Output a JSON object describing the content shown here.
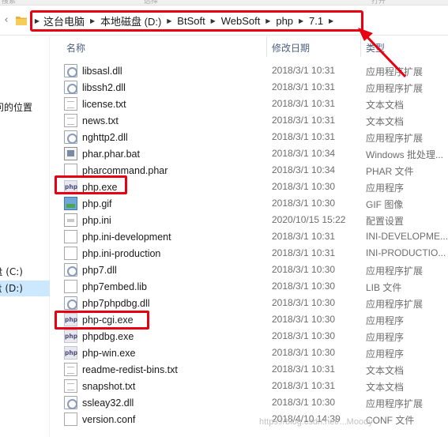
{
  "top_strip": {
    "left": "搜索",
    "middle": "选择",
    "right": "打开"
  },
  "breadcrumb": [
    "这台电脑",
    "本地磁盘 (D:)",
    "BtSoft",
    "WebSoft",
    "php",
    "7.1"
  ],
  "sidebar": {
    "items": [
      {
        "label": "问的位置"
      },
      {
        "label": "盘 (C:)"
      },
      {
        "label": "盘 (D:)"
      }
    ]
  },
  "columns": {
    "name": "名称",
    "date": "修改日期",
    "type": "类型"
  },
  "files": [
    {
      "name": "libsasl.dll",
      "date": "2018/3/1 10:31",
      "type": "应用程序扩展",
      "icon": "dll-icon"
    },
    {
      "name": "libssh2.dll",
      "date": "2018/3/1 10:31",
      "type": "应用程序扩展",
      "icon": "dll-icon"
    },
    {
      "name": "license.txt",
      "date": "2018/3/1 10:31",
      "type": "文本文档",
      "icon": "text-file-icon"
    },
    {
      "name": "news.txt",
      "date": "2018/3/1 10:31",
      "type": "文本文档",
      "icon": "text-file-icon"
    },
    {
      "name": "nghttp2.dll",
      "date": "2018/3/1 10:31",
      "type": "应用程序扩展",
      "icon": "dll-icon"
    },
    {
      "name": "phar.phar.bat",
      "date": "2018/3/1 10:34",
      "type": "Windows 批处理...",
      "icon": "batch-file-icon"
    },
    {
      "name": "pharcommand.phar",
      "date": "2018/3/1 10:34",
      "type": "PHAR 文件",
      "icon": "generic-file-icon"
    },
    {
      "name": "php.exe",
      "date": "2018/3/1 10:30",
      "type": "应用程序",
      "icon": "php-exe-icon"
    },
    {
      "name": "php.gif",
      "date": "2018/3/1 10:30",
      "type": "GIF 图像",
      "icon": "gif-image-icon"
    },
    {
      "name": "php.ini",
      "date": "2020/10/15 15:22",
      "type": "配置设置",
      "icon": "ini-file-icon"
    },
    {
      "name": "php.ini-development",
      "date": "2018/3/1 10:31",
      "type": "INI-DEVELOPME...",
      "icon": "generic-file-icon"
    },
    {
      "name": "php.ini-production",
      "date": "2018/3/1 10:31",
      "type": "INI-PRODUCTIO...",
      "icon": "generic-file-icon"
    },
    {
      "name": "php7.dll",
      "date": "2018/3/1 10:30",
      "type": "应用程序扩展",
      "icon": "dll-icon"
    },
    {
      "name": "php7embed.lib",
      "date": "2018/3/1 10:30",
      "type": "LIB 文件",
      "icon": "generic-file-icon"
    },
    {
      "name": "php7phpdbg.dll",
      "date": "2018/3/1 10:30",
      "type": "应用程序扩展",
      "icon": "dll-icon"
    },
    {
      "name": "php-cgi.exe",
      "date": "2018/3/1 10:30",
      "type": "应用程序",
      "icon": "php-exe-icon"
    },
    {
      "name": "phpdbg.exe",
      "date": "2018/3/1 10:30",
      "type": "应用程序",
      "icon": "php-exe-icon"
    },
    {
      "name": "php-win.exe",
      "date": "2018/3/1 10:30",
      "type": "应用程序",
      "icon": "php-exe-icon"
    },
    {
      "name": "readme-redist-bins.txt",
      "date": "2018/3/1 10:31",
      "type": "文本文档",
      "icon": "text-file-icon"
    },
    {
      "name": "snapshot.txt",
      "date": "2018/3/1 10:31",
      "type": "文本文档",
      "icon": "text-file-icon"
    },
    {
      "name": "ssleay32.dll",
      "date": "2018/3/1 10:30",
      "type": "应用程序扩展",
      "icon": "dll-icon"
    },
    {
      "name": "version.conf",
      "date": "2018/4/10 14:39",
      "type": "CONF 文件",
      "icon": "generic-file-icon"
    }
  ],
  "php_icon_text": "php",
  "watermark": "https://blog.csdn.net/...Moody",
  "colors": {
    "highlight_red": "#e60012",
    "selected_blue": "#cce8ff",
    "header_text": "#4d6082"
  }
}
